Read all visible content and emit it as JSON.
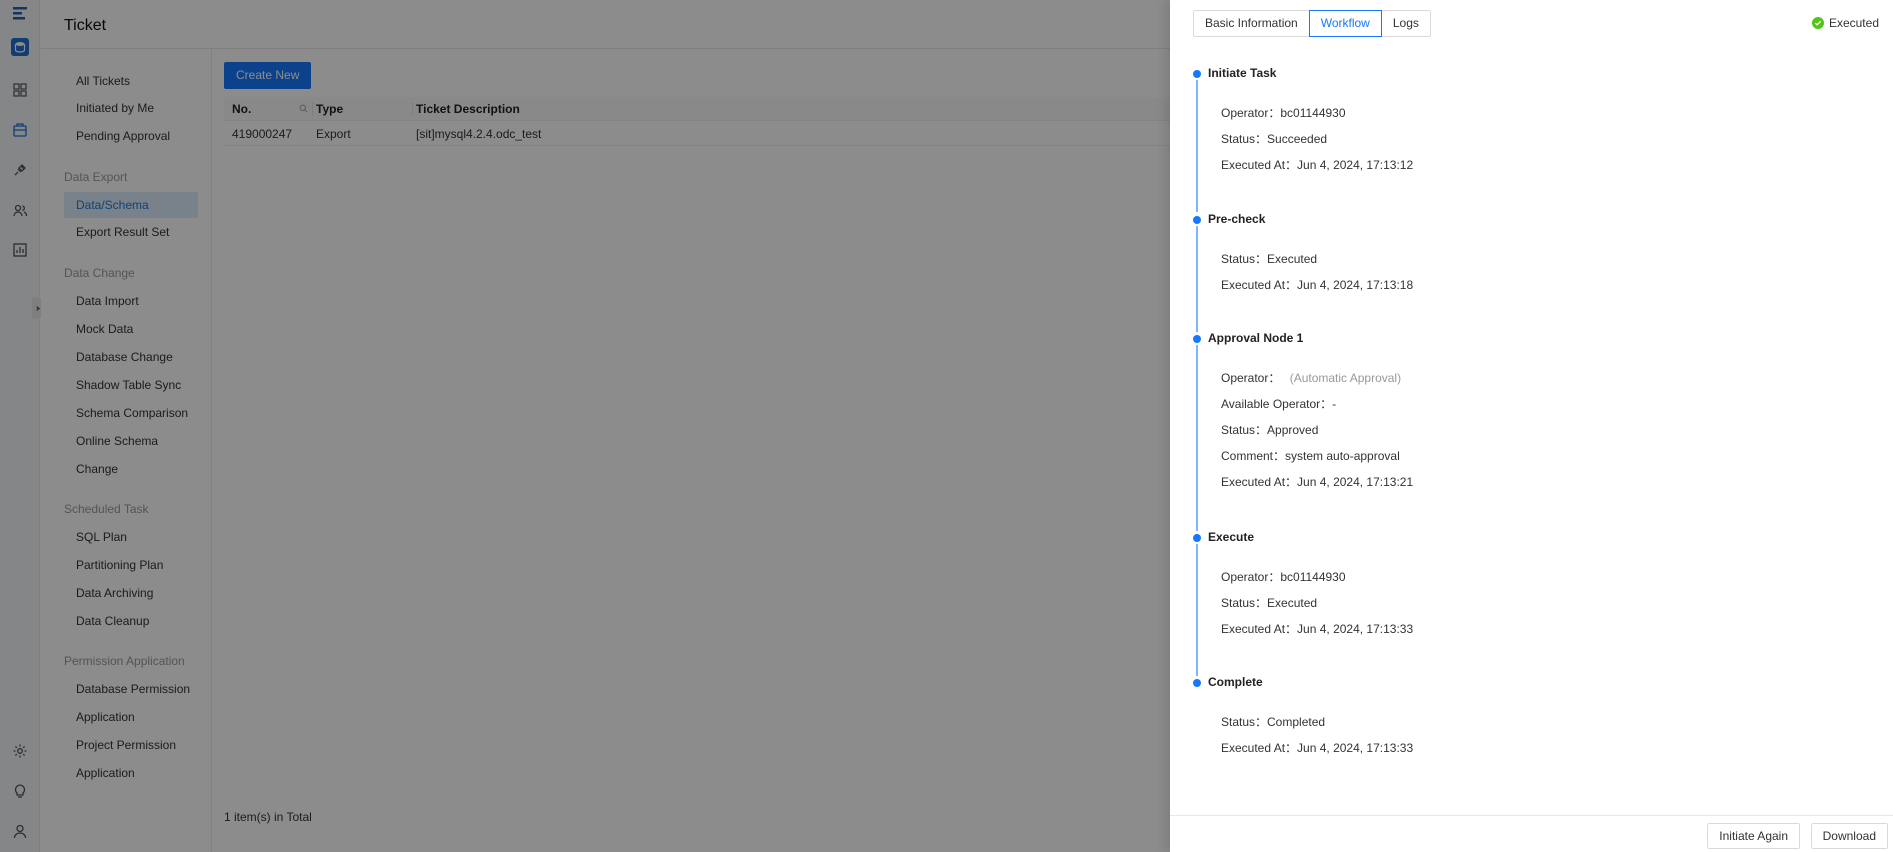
{
  "rail": {
    "icons": [
      "logo-icon",
      "database-icon",
      "grid-icon",
      "ticket-icon",
      "plug-icon",
      "users-icon",
      "report-icon",
      "gear-icon",
      "bulb-icon",
      "user-icon"
    ]
  },
  "header": {
    "title": "Ticket"
  },
  "sidebar": {
    "all_tickets": "All Tickets",
    "initiated_by_me": "Initiated by Me",
    "pending_approval": "Pending Approval",
    "group_export": "Data Export",
    "data_schema": "Data/Schema",
    "export_result_set": "Export Result Set",
    "group_change": "Data Change",
    "data_import": "Data Import",
    "mock_data": "Mock Data",
    "database_change": "Database Change",
    "shadow_table_sync": "Shadow Table Sync",
    "schema_comparison": "Schema Comparison",
    "online_schema": "Online Schema",
    "online_schema_2": "Change",
    "group_scheduled": "Scheduled Task",
    "sql_plan": "SQL Plan",
    "partitioning_plan": "Partitioning Plan",
    "data_archiving": "Data Archiving",
    "data_cleanup": "Data Cleanup",
    "group_permission": "Permission Application",
    "db_permission": "Database Permission",
    "db_permission_2": "Application",
    "project_permission": "Project Permission",
    "project_permission_2": "Application"
  },
  "main": {
    "create_label": "Create New",
    "columns": {
      "no": "No.",
      "type": "Type",
      "desc": "Ticket Description"
    },
    "row": {
      "no": "419000247",
      "type": "Export",
      "desc": "[sit]mysql4.2.4.odc_test"
    },
    "total": "1 item(s) in Total"
  },
  "drawer": {
    "tabs": {
      "basic": "Basic Information",
      "workflow": "Workflow",
      "logs": "Logs"
    },
    "status": "Executed",
    "accent": "#1677ff",
    "steps": {
      "initiate": {
        "name": "Initiate Task",
        "operator": "Operator：bc01144930",
        "status": "Status：Succeeded",
        "executed": "Executed At：Jun 4, 2024, 17:13:12"
      },
      "precheck": {
        "name": "Pre-check",
        "status": "Status：Executed",
        "executed": "Executed At：Jun 4, 2024, 17:13:18"
      },
      "approval": {
        "name": "Approval Node 1",
        "operator_label": "Operator：",
        "operator_value": "(Automatic Approval)",
        "available": "Available Operator：-",
        "status": "Status：Approved",
        "comment": "Comment：system auto-approval",
        "executed": "Executed At：Jun 4, 2024, 17:13:21"
      },
      "execute": {
        "name": "Execute",
        "operator": "Operator：bc01144930",
        "status": "Status：Executed",
        "executed": "Executed At：Jun 4, 2024, 17:13:33"
      },
      "complete": {
        "name": "Complete",
        "status": "Status：Completed",
        "executed": "Executed At：Jun 4, 2024, 17:13:33"
      }
    },
    "footer": {
      "initiate_again": "Initiate Again",
      "download": "Download"
    }
  }
}
